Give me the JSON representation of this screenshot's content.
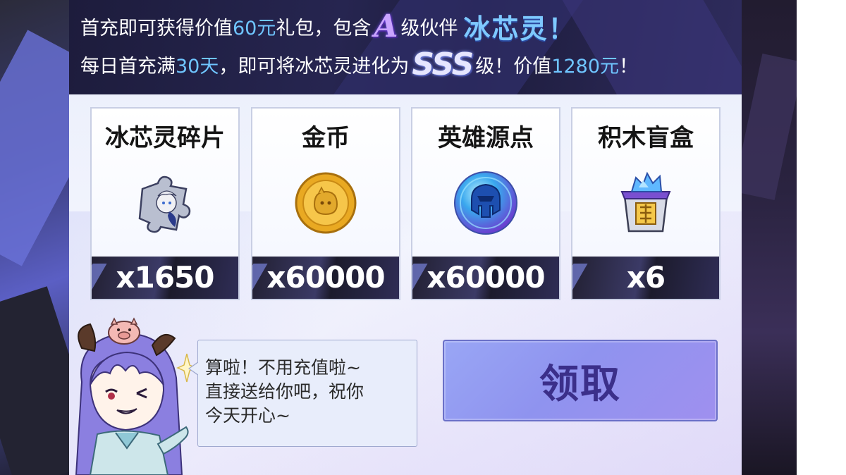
{
  "banner": {
    "line1_prefix": "首充即可获得价值",
    "line1_amount": "60元",
    "line1_mid": "礼包，包含",
    "line1_grade": "A",
    "line1_suffix": "级伙伴",
    "line1_name": "冰芯灵！",
    "line2_prefix": "每日首充满",
    "line2_days": "30天",
    "line2_mid": "，即可将冰芯灵进化为",
    "line2_grade": "SSS",
    "line2_suffix1": "级！价值",
    "line2_value": "1280元",
    "line2_suffix2": "！"
  },
  "rewards": [
    {
      "name": "冰芯灵碎片",
      "count": "x1650",
      "icon": "puzzle-piece-icon"
    },
    {
      "name": "金币",
      "count": "x60000",
      "icon": "gold-coin-icon"
    },
    {
      "name": "英雄源点",
      "count": "x60000",
      "icon": "hero-orb-icon"
    },
    {
      "name": "积木盲盒",
      "count": "x6",
      "icon": "blind-box-icon"
    }
  ],
  "bubble": {
    "line1": "算啦！不用充值啦~",
    "line2": "直接送给你吧，祝你",
    "line3": "今天开心~"
  },
  "claim": {
    "label": "领取"
  },
  "colors": {
    "accent_blue": "#6fc5ff",
    "button": "#9aa3f2",
    "button_text": "#3b2f8a",
    "banner_bg": "#1d1c3c"
  }
}
